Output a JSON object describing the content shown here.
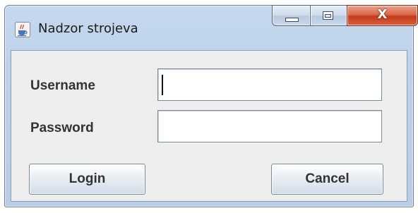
{
  "window": {
    "title": "Nadzor strojeva",
    "app_icon": "java-cup-icon",
    "caption_buttons": {
      "minimize_icon": "minimize-icon",
      "maximize_icon": "maximize-icon",
      "close_icon": "close-icon",
      "close_glyph": "X"
    }
  },
  "form": {
    "username_label": "Username",
    "password_label": "Password",
    "username_value": "",
    "password_value": "",
    "login_label": "Login",
    "cancel_label": "Cancel"
  },
  "colors": {
    "frame": "#bdd2ea",
    "client_bg": "#eeeeee",
    "close_red": "#c43a1b",
    "label_text": "#333333"
  }
}
